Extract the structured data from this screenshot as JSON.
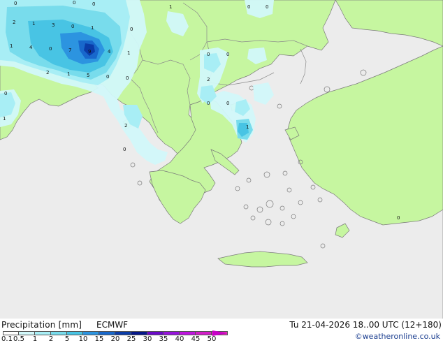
{
  "legend": {
    "title": "Precipitation [mm]",
    "model": "ECMWF",
    "datetime": "Tu 21-04-2026 18..00 UTC (12+180)",
    "credit": "©weatheronline.co.uk",
    "ticks": [
      "0.1",
      "0.5",
      "1",
      "2",
      "5",
      "10",
      "15",
      "20",
      "25",
      "30",
      "35",
      "40",
      "45",
      "50"
    ],
    "colors": [
      "#ffffff",
      "#d2f8fa",
      "#a8eef5",
      "#78dcec",
      "#48c4e4",
      "#2c94e0",
      "#1868cc",
      "#0a3ca8",
      "#06188a",
      "#6a0ac8",
      "#9614dc",
      "#be14e0",
      "#d21ec8",
      "#e432b4"
    ]
  },
  "map": {
    "colors": {
      "sea": "#ececec",
      "land": "#c6f6a0",
      "coast": "#7a7a7a",
      "border": "#8a8a8a"
    },
    "values": [
      "0",
      "1",
      "2",
      "3",
      "4",
      "5",
      "6",
      "7",
      "8",
      "9"
    ]
  }
}
